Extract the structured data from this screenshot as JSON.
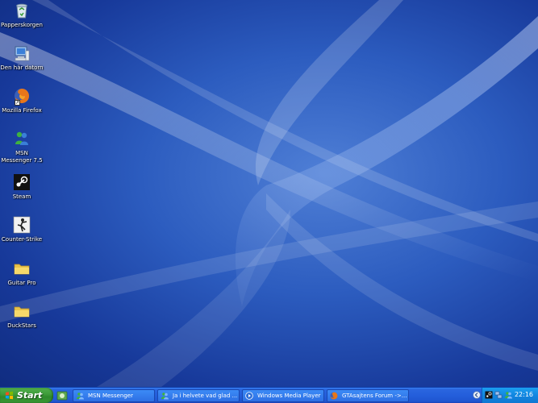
{
  "desktop": {
    "icons": [
      {
        "label": "Papperskorgen",
        "icon": "recycle-bin-icon"
      },
      {
        "label": "Den här datorn",
        "icon": "my-computer-icon"
      },
      {
        "label": "Mozilla Firefox",
        "icon": "firefox-icon"
      },
      {
        "label": "MSN Messenger 7.5",
        "icon": "msn-messenger-icon"
      },
      {
        "label": "Steam",
        "icon": "steam-icon"
      },
      {
        "label": "Counter-Strike",
        "icon": "counter-strike-icon"
      },
      {
        "label": "Guitar Pro",
        "icon": "folder-icon"
      },
      {
        "label": "DuckStars",
        "icon": "folder-icon"
      }
    ]
  },
  "taskbar": {
    "start_label": "Start",
    "tasks": [
      {
        "label": "MSN Messenger",
        "icon": "msn-messenger-icon"
      },
      {
        "label": "Ja i helvete vad glad ...",
        "icon": "msn-chat-icon"
      },
      {
        "label": "Windows Media Player",
        "icon": "media-player-icon"
      },
      {
        "label": "GTAsajtens Forum ->...",
        "icon": "firefox-icon"
      }
    ],
    "clock": "22:16"
  },
  "colors": {
    "desktop_bg": "#2c5cbf",
    "taskbar": "#245edb",
    "start_button": "#3c9a38",
    "tray": "#1286e0"
  }
}
